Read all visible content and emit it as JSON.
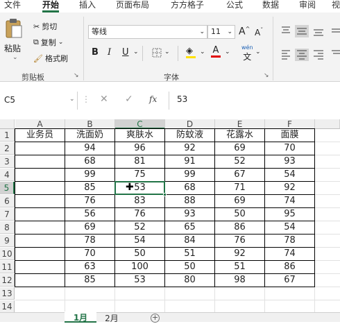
{
  "ribbon_tabs": [
    "文件",
    "开始",
    "插入",
    "页面布局",
    "方方格子",
    "公式",
    "数据",
    "审阅",
    "视"
  ],
  "clipboard": {
    "paste": "粘贴",
    "cut": "剪切",
    "copy": "复制",
    "format_painter": "格式刷",
    "group": "剪贴板"
  },
  "font": {
    "name": "等线",
    "size": "11",
    "grow": "A",
    "shrink": "A",
    "bold": "B",
    "italic": "I",
    "underline": "U",
    "font_color": "A",
    "phonetic": "wén",
    "group": "字体"
  },
  "name_box": "C5",
  "fx": "fx",
  "formula_value": "53",
  "columns": [
    "A",
    "B",
    "C",
    "D",
    "E",
    "F"
  ],
  "rows": [
    "1",
    "2",
    "3",
    "4",
    "5",
    "6",
    "7",
    "8",
    "9",
    "10",
    "11",
    "12",
    "13",
    "14"
  ],
  "header_row": [
    "业务员",
    "洗面奶",
    "爽肤水",
    "防蚊液",
    "花露水",
    "面膜"
  ],
  "table": [
    [
      "",
      "94",
      "96",
      "92",
      "69",
      "70"
    ],
    [
      "",
      "68",
      "81",
      "91",
      "52",
      "93"
    ],
    [
      "",
      "99",
      "75",
      "99",
      "67",
      "54"
    ],
    [
      "",
      "85",
      "53",
      "68",
      "71",
      "92"
    ],
    [
      "",
      "76",
      "83",
      "88",
      "69",
      "74"
    ],
    [
      "",
      "56",
      "76",
      "93",
      "50",
      "95"
    ],
    [
      "",
      "69",
      "52",
      "65",
      "86",
      "54"
    ],
    [
      "",
      "78",
      "54",
      "84",
      "76",
      "78"
    ],
    [
      "",
      "70",
      "50",
      "51",
      "92",
      "74"
    ],
    [
      "",
      "63",
      "100",
      "50",
      "51",
      "86"
    ],
    [
      "",
      "85",
      "53",
      "80",
      "98",
      "67"
    ]
  ],
  "sheet_tabs": [
    "1月",
    "2月"
  ],
  "active_sheet": "1月",
  "colors": {
    "accent": "#217346",
    "selection": "#217346",
    "header_bg": "#efefef",
    "ribbon_bg": "#f3f3f3"
  }
}
